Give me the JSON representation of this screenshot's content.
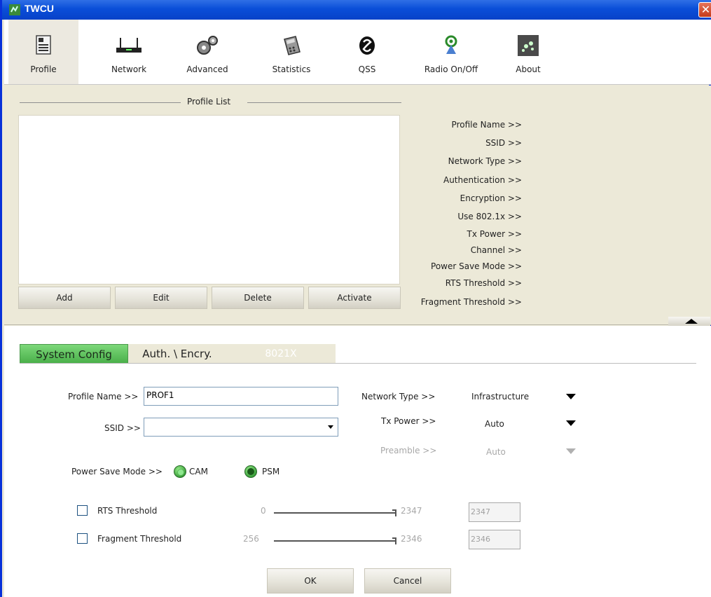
{
  "window": {
    "title": "TWCU",
    "close_glyph": "✕"
  },
  "toolbar": [
    {
      "label": "Profile",
      "icon": "profile-icon"
    },
    {
      "label": "Network",
      "icon": "router-icon"
    },
    {
      "label": "Advanced",
      "icon": "gears-icon"
    },
    {
      "label": "Statistics",
      "icon": "calculator-icon"
    },
    {
      "label": "QSS",
      "icon": "qss-icon"
    },
    {
      "label": "Radio On/Off",
      "icon": "radio-icon"
    },
    {
      "label": "About",
      "icon": "about-icon"
    }
  ],
  "profile_list": {
    "title": "Profile List",
    "buttons": {
      "add": "Add",
      "edit": "Edit",
      "delete": "Delete",
      "activate": "Activate"
    }
  },
  "profile_info": [
    "Profile Name >>",
    "SSID >>",
    "Network Type >>",
    "Authentication >>",
    "Encryption >>",
    "Use 802.1x >>",
    "Tx Power >>",
    "Channel >>",
    "Power Save Mode >>",
    "RTS Threshold >>",
    "Fragment Threshold >>"
  ],
  "tabs": {
    "system_config": "System Config",
    "auth_encry": "Auth. \\ Encry.",
    "x8021": "8021X"
  },
  "form": {
    "profile_name_label": "Profile Name >>",
    "profile_name_value": "PROF1",
    "ssid_label": "SSID >>",
    "ssid_value": "",
    "network_type_label": "Network Type >>",
    "network_type_value": "Infrastructure",
    "tx_power_label": "Tx Power >>",
    "tx_power_value": "Auto",
    "preamble_label": "Preamble >>",
    "preamble_value": "Auto",
    "power_save_label": "Power Save Mode >>",
    "cam_label": "CAM",
    "psm_label": "PSM",
    "power_save_selected": "PSM",
    "rts": {
      "label": "RTS Threshold",
      "min": "0",
      "max": "2347",
      "value": "2347",
      "checked": false
    },
    "frag": {
      "label": "Fragment Threshold",
      "min": "256",
      "max": "2346",
      "value": "2346",
      "checked": false
    }
  },
  "footer": {
    "ok": "OK",
    "cancel": "Cancel"
  }
}
